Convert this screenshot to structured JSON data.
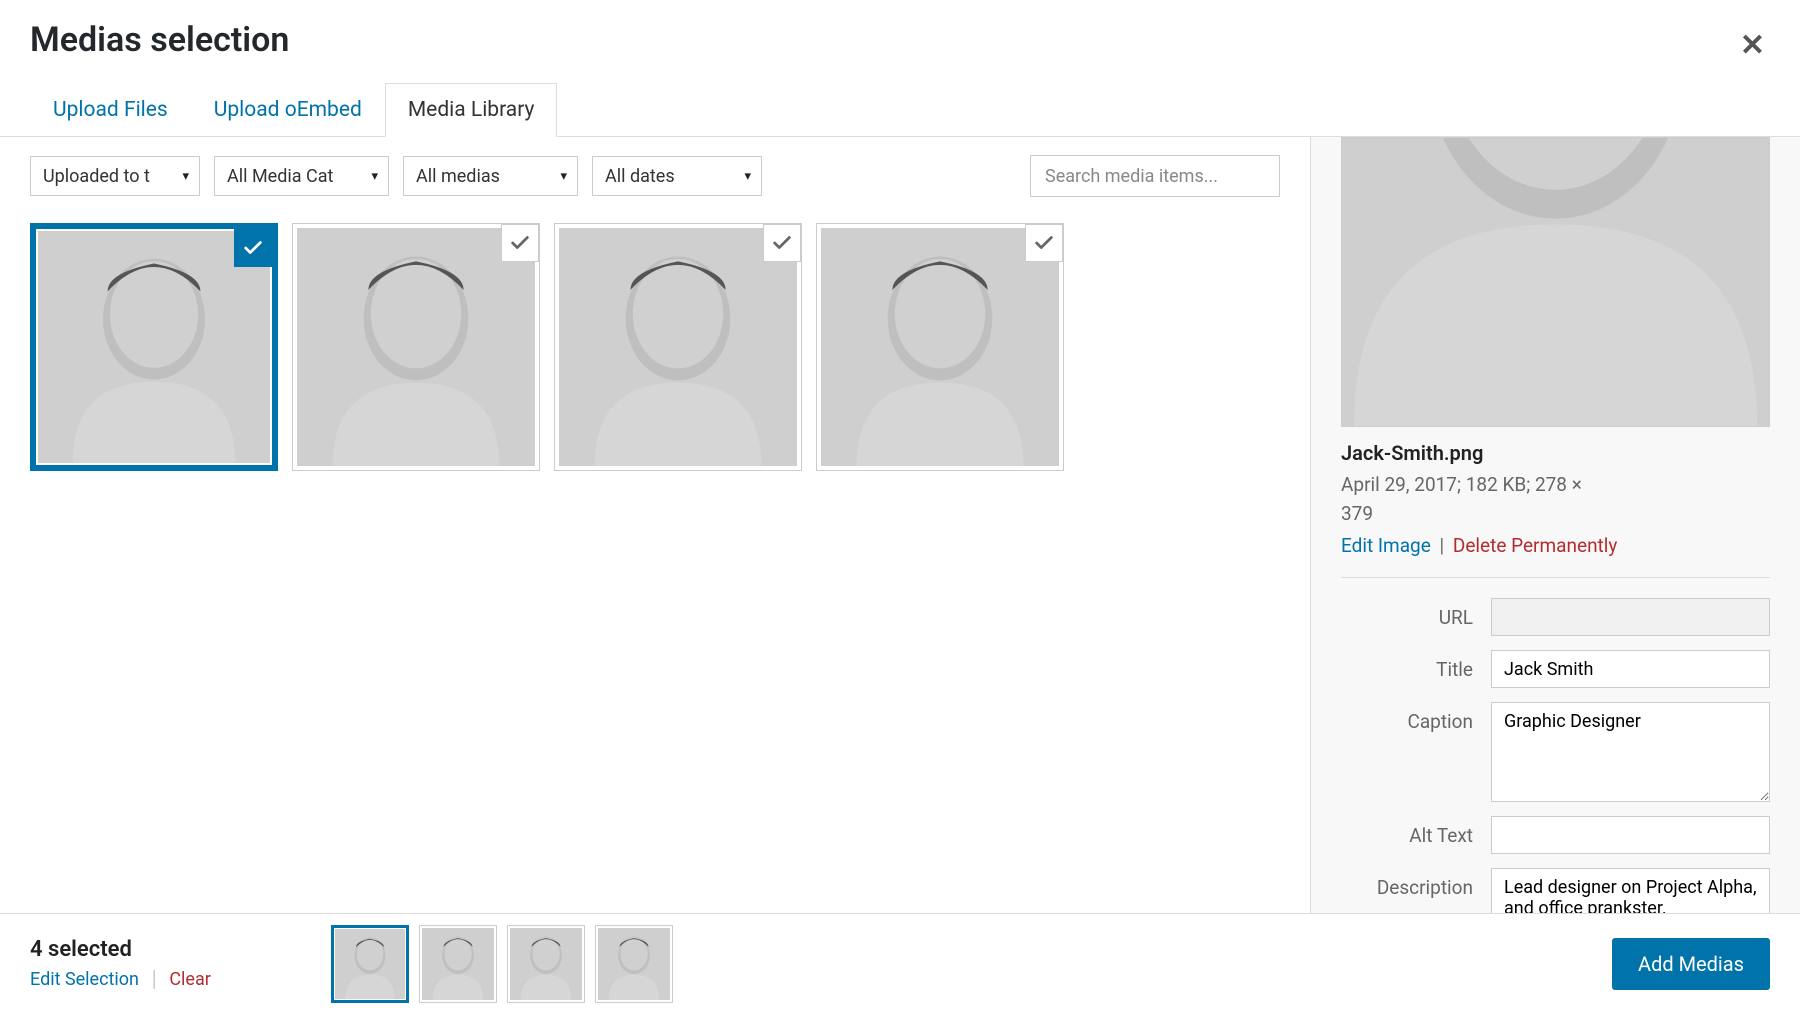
{
  "header": {
    "title": "Medias selection"
  },
  "tabs": {
    "upload_files": "Upload Files",
    "upload_oembed": "Upload oEmbed",
    "media_library": "Media Library"
  },
  "filters": {
    "source": "Uploaded to t",
    "category": "All Media Cat",
    "type": "All medias",
    "date": "All dates"
  },
  "search": {
    "placeholder": "Search media items..."
  },
  "details": {
    "filename": "Jack-Smith.png",
    "meta1": "April 29, 2017;  182 KB;  278 ×",
    "meta2": "379",
    "edit_label": "Edit Image",
    "delete_label": "Delete Permanently",
    "url_label": "URL",
    "url_value": "",
    "title_label": "Title",
    "title_value": "Jack Smith",
    "caption_label": "Caption",
    "caption_value": "Graphic Designer",
    "alt_label": "Alt Text",
    "alt_value": "",
    "desc_label": "Description",
    "desc_value": "Lead designer on Project Alpha, and office prankster."
  },
  "footer": {
    "selected_text": "4 selected",
    "edit_selection": "Edit Selection",
    "clear": "Clear",
    "add_button": "Add Medias"
  }
}
